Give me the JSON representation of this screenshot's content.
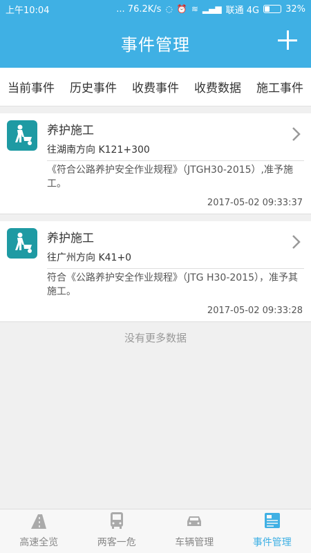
{
  "status_bar": {
    "time": "上午10:04",
    "speed": "... 76.2K/s",
    "carrier": "联通 4G",
    "battery_percent": "32%",
    "battery_level": 0.32
  },
  "header": {
    "title": "事件管理"
  },
  "tabs": [
    {
      "label": "当前事件",
      "active": true
    },
    {
      "label": "历史事件",
      "active": false
    },
    {
      "label": "收费事件",
      "active": false
    },
    {
      "label": "收费数据",
      "active": false
    },
    {
      "label": "施工事件",
      "active": false
    }
  ],
  "events": [
    {
      "type": "养护施工",
      "direction": "往湖南方向  K121+300",
      "description": "《符合公路养护安全作业规程》（JTGH30-2015）,准予施工。",
      "time": "2017-05-02 09:33:37"
    },
    {
      "type": "养护施工",
      "direction": "往广州方向  K41+0",
      "description": "符合《公路养护安全作业规程》（JTG H30-2015），准予其施工。",
      "time": "2017-05-02 09:33:28"
    }
  ],
  "no_more_text": "没有更多数据",
  "bottom_nav": [
    {
      "label": "高速全览",
      "icon": "highway-icon",
      "active": false
    },
    {
      "label": "两客一危",
      "icon": "bus-icon",
      "active": false
    },
    {
      "label": "车辆管理",
      "icon": "car-icon",
      "active": false
    },
    {
      "label": "事件管理",
      "icon": "event-icon",
      "active": true
    }
  ],
  "colors": {
    "primary": "#3fb0e4",
    "event_icon_bg": "#1e9aa3"
  }
}
